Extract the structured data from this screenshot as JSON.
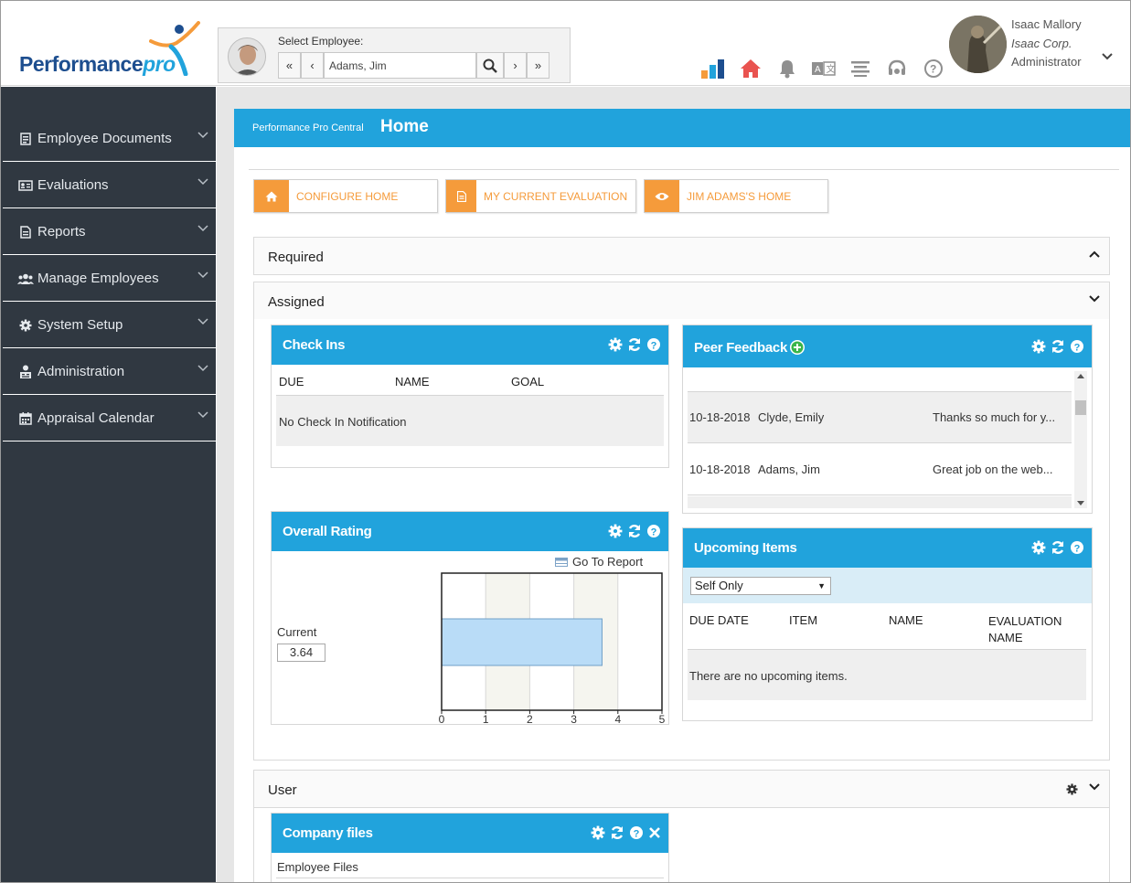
{
  "header": {
    "logo_main": "Performance",
    "logo_pro": "pro",
    "select_employee_label": "Select Employee:",
    "employee_value": "Adams, Jim",
    "nav_first": "«",
    "nav_prev": "‹",
    "nav_next": "›",
    "nav_last": "»",
    "user_name": "Isaac Mallory",
    "user_company": "Isaac Corp.",
    "user_role": "Administrator"
  },
  "sidebar": {
    "items": [
      {
        "label": "Employee Documents",
        "icon": "document-icon"
      },
      {
        "label": "Evaluations",
        "icon": "id-card-icon"
      },
      {
        "label": "Reports",
        "icon": "report-icon"
      },
      {
        "label": "Manage Employees",
        "icon": "users-icon"
      },
      {
        "label": "System Setup",
        "icon": "gear-icon"
      },
      {
        "label": "Administration",
        "icon": "admin-icon"
      },
      {
        "label": "Appraisal Calendar",
        "icon": "calendar-icon"
      }
    ]
  },
  "page": {
    "breadcrumb": "Performance Pro Central",
    "title": "Home"
  },
  "quick_buttons": [
    {
      "label": "CONFIGURE HOME"
    },
    {
      "label": "MY CURRENT EVALUATION"
    },
    {
      "label": "JIM ADAMS'S HOME"
    }
  ],
  "sections": {
    "required": "Required",
    "assigned": "Assigned",
    "user": "User"
  },
  "check_ins": {
    "title": "Check Ins",
    "columns": [
      "DUE",
      "NAME",
      "GOAL"
    ],
    "empty": "No Check In Notification"
  },
  "peer_feedback": {
    "title": "Peer Feedback",
    "rows": [
      {
        "date": "10-18-2018",
        "name": "Clyde, Emily",
        "comment": "Thanks so much for y..."
      },
      {
        "date": "10-18-2018",
        "name": "Adams, Jim",
        "comment": "Great job on the web..."
      }
    ]
  },
  "overall_rating": {
    "title": "Overall Rating",
    "go_to_report": "Go To Report",
    "current_label": "Current",
    "current_value": "3.64"
  },
  "upcoming_items": {
    "title": "Upcoming Items",
    "filter": "Self Only",
    "columns": [
      "DUE DATE",
      "ITEM",
      "NAME",
      "EVALUATION NAME"
    ],
    "empty": "There are no upcoming items."
  },
  "company_files": {
    "title": "Company files",
    "first_row": "Employee Files"
  },
  "chart_data": {
    "type": "bar",
    "orientation": "horizontal",
    "categories": [
      "Current"
    ],
    "values": [
      3.64
    ],
    "xlim": [
      0,
      5
    ],
    "xticks": [
      "0",
      "1",
      "2",
      "3",
      "4",
      "5"
    ],
    "grid": true,
    "bar_color": "#b9dcf7"
  },
  "colors": {
    "brand_blue": "#21a3dc",
    "accent_orange": "#f59b3b",
    "sidebar": "#303841"
  }
}
